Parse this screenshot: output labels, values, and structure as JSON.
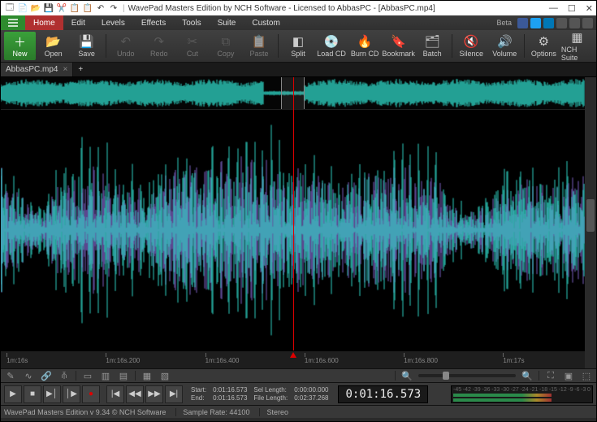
{
  "window": {
    "title": "WavePad Masters Edition by NCH Software - Licensed to AbbasPC - [AbbasPC.mp4]",
    "controls": {
      "min": "—",
      "max": "☐",
      "close": "✕"
    }
  },
  "menu": {
    "items": [
      "Home",
      "Edit",
      "Levels",
      "Effects",
      "Tools",
      "Suite",
      "Custom"
    ],
    "active_index": 0,
    "beta": "Beta"
  },
  "ribbon": {
    "new": "New",
    "open": "Open",
    "save": "Save",
    "undo": "Undo",
    "redo": "Redo",
    "cut": "Cut",
    "copy": "Copy",
    "paste": "Paste",
    "split": "Split",
    "loadcd": "Load CD",
    "burncd": "Burn CD",
    "bookmark": "Bookmark",
    "batch": "Batch",
    "silence": "Silence",
    "volume": "Volume",
    "options": "Options",
    "nchsuite": "NCH Suite"
  },
  "filetabs": {
    "tabs": [
      {
        "name": "AbbasPC.mp4"
      }
    ],
    "add": "+",
    "close": "×"
  },
  "timeline": {
    "ticks": [
      "1m:16s",
      "1m:16s.200",
      "1m:16s.400",
      "1m:16s.600",
      "1m:16s.800",
      "1m:17s"
    ],
    "playhead_pct": 50
  },
  "transport": {
    "start_label": "Start:",
    "start_val": "0:01:16.573",
    "end_label": "End:",
    "end_val": "0:01:16.573",
    "sel_label": "Sel Length:",
    "sel_val": "0:00:00.000",
    "file_label": "File Length:",
    "file_val": "0:02:37.268",
    "bigtime": "0:01:16.573",
    "meter_ticks": [
      "-45",
      "-42",
      "-39",
      "-36",
      "-33",
      "-30",
      "-27",
      "-24",
      "-21",
      "-18",
      "-15",
      "-12",
      "-9",
      "-6",
      "-3",
      "0"
    ]
  },
  "status": {
    "app": "WavePad Masters Edition v 9.34 © NCH Software",
    "sample": "Sample Rate: 44100",
    "stereo": "Stereo"
  },
  "colors": {
    "wave1": "#2fd4c4",
    "wave2": "#7a5fbf"
  }
}
